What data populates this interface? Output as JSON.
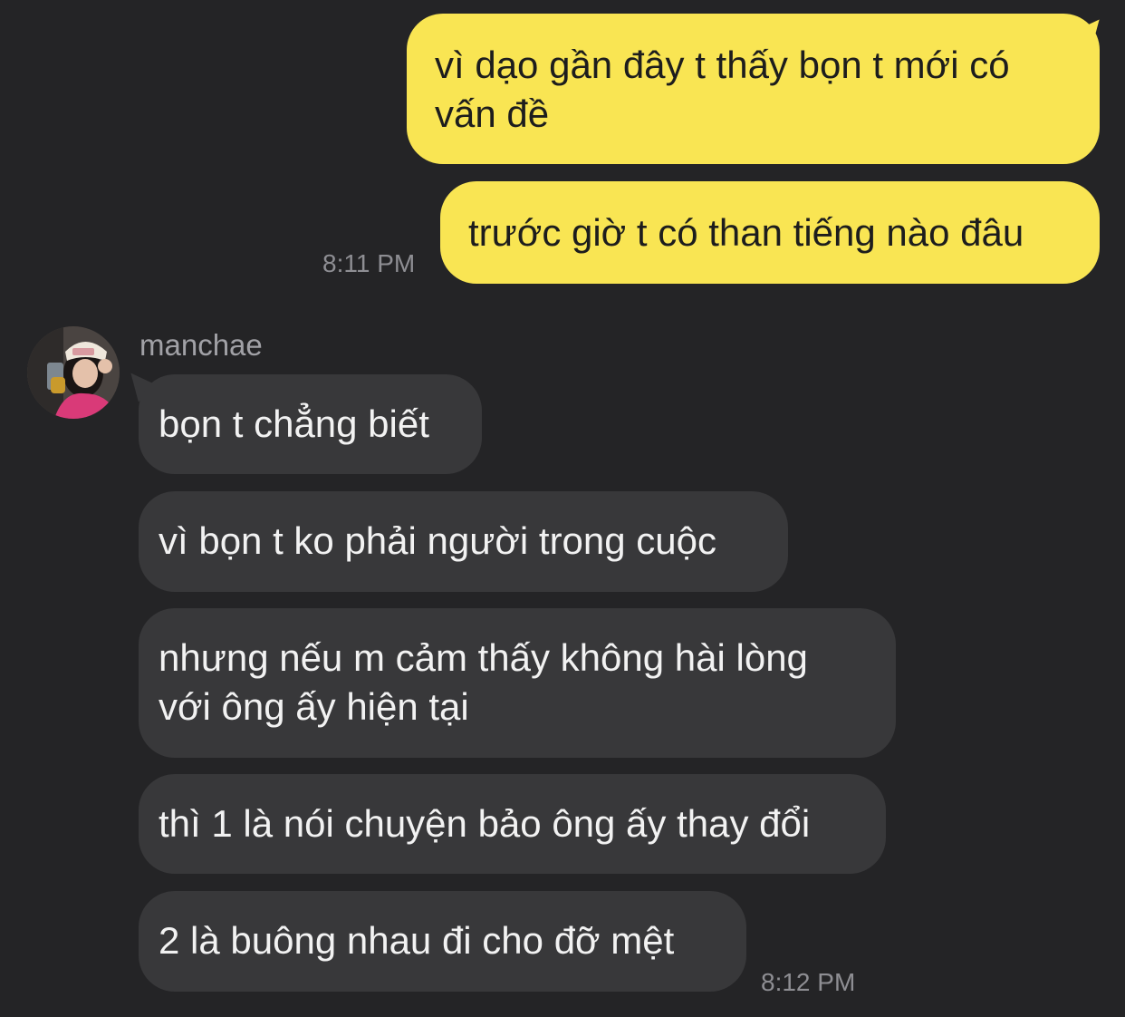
{
  "conversation": {
    "outgoing": [
      {
        "text_line1": "vì dạo gần đây t thấy bọn t mới có",
        "text_line2": "vấn đề"
      },
      {
        "text": "trước giờ t có than tiếng nào đâu"
      }
    ],
    "outgoing_time": "8:11 PM",
    "contact": {
      "name": "manchae",
      "avatar": "profile-photo"
    },
    "incoming": [
      {
        "text": "bọn t chẳng biết"
      },
      {
        "text": "vì bọn t ko phải người trong cuộc"
      },
      {
        "text_line1": "nhưng nếu m cảm thấy không hài lòng",
        "text_line2": "với ông ấy hiện tại"
      },
      {
        "text": "thì 1 là nói chuyện bảo ông ấy thay đổi"
      },
      {
        "text": "2 là buông nhau đi cho đỡ mệt"
      }
    ],
    "incoming_time": "8:12 PM"
  },
  "colors": {
    "background": "#242426",
    "outgoing_bubble": "#f9e553",
    "incoming_bubble": "#38383a",
    "timestamp": "#8e8e93"
  }
}
